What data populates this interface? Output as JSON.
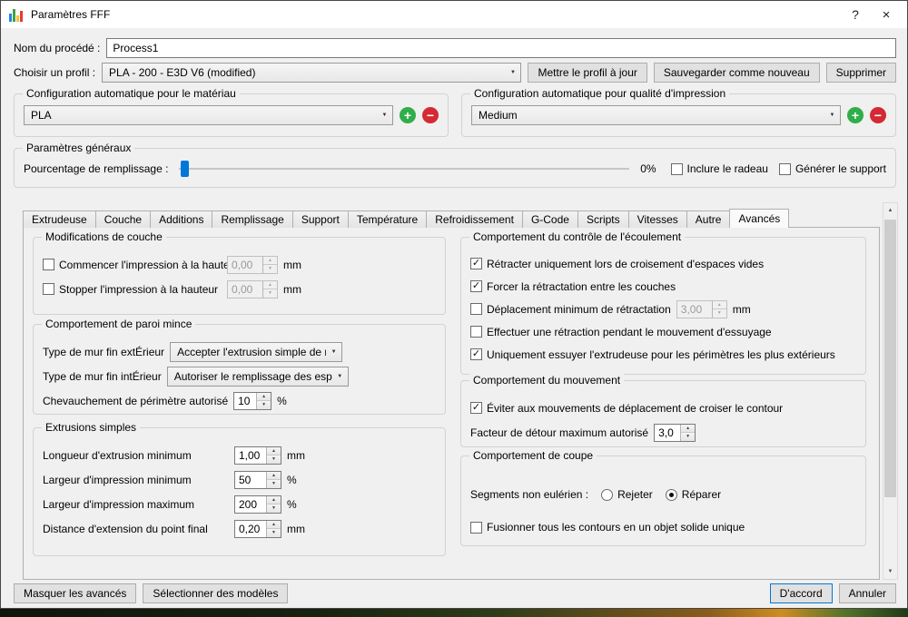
{
  "icons": {
    "up": "▲",
    "down": "▼",
    "dropdown": "▼",
    "scroll_up": "▲",
    "scroll_down": "▼"
  },
  "colors": {
    "accent_blue": "#0078d7",
    "add_green": "#2fae49",
    "remove_red": "#d42a33"
  },
  "window": {
    "title": "Paramètres FFF",
    "help": "?",
    "close": "×"
  },
  "header": {
    "process_label": "Nom du procédé :",
    "process_value": "Process1",
    "profile_label": "Choisir un profil :",
    "profile_value": "PLA - 200 - E3D V6 (modified)",
    "btn_update": "Mettre le profil à jour",
    "btn_save_new": "Sauvegarder comme nouveau",
    "btn_delete": "Supprimer"
  },
  "auto_material": {
    "title": "Configuration automatique pour le matériau",
    "value": "PLA",
    "add": "+",
    "remove": "−"
  },
  "auto_quality": {
    "title": "Configuration automatique pour qualité d'impression",
    "value": "Medium",
    "add": "+",
    "remove": "−"
  },
  "general": {
    "title": "Paramètres généraux",
    "infill_label": "Pourcentage de remplissage :",
    "infill_percent": "0%",
    "raft": {
      "label": "Inclure le radeau",
      "checked": false
    },
    "support": {
      "label": "Générer le support",
      "checked": false
    }
  },
  "tabs": {
    "items": [
      {
        "label": "Extrudeuse",
        "active": false
      },
      {
        "label": "Couche",
        "active": false
      },
      {
        "label": "Additions",
        "active": false
      },
      {
        "label": "Remplissage",
        "active": false
      },
      {
        "label": "Support",
        "active": false
      },
      {
        "label": "Température",
        "active": false
      },
      {
        "label": "Refroidissement",
        "active": false
      },
      {
        "label": "G-Code",
        "active": false
      },
      {
        "label": "Scripts",
        "active": false
      },
      {
        "label": "Vitesses",
        "active": false
      },
      {
        "label": "Autre",
        "active": false
      },
      {
        "label": "Avancés",
        "active": true
      }
    ]
  },
  "layer_mod": {
    "title": "Modifications de couche",
    "start": {
      "label": "Commencer l'impression à la hauteur",
      "checked": false,
      "value": "0,00",
      "unit": "mm"
    },
    "stop": {
      "label": "Stopper l'impression à la hauteur",
      "checked": false,
      "value": "0,00",
      "unit": "mm"
    }
  },
  "thin_wall": {
    "title": "Comportement de paroi mince",
    "external_label": "Type de mur fin extÉrieur",
    "external_value": "Accepter l'extrusion simple de murs",
    "internal_label": "Type de mur fin intÉrieur",
    "internal_value": "Autoriser le remplissage des espaces",
    "overlap_label": "Chevauchement de périmètre autorisé",
    "overlap_value": "10",
    "overlap_unit": "%"
  },
  "single_extrusion": {
    "title": "Extrusions simples",
    "rows": [
      {
        "label": "Longueur d'extrusion minimum",
        "value": "1,00",
        "unit": "mm"
      },
      {
        "label": "Largeur d'impression minimum",
        "value": "50",
        "unit": "%"
      },
      {
        "label": "Largeur d'impression maximum",
        "value": "200",
        "unit": "%"
      },
      {
        "label": "Distance d'extension du point final",
        "value": "0,20",
        "unit": "mm"
      }
    ]
  },
  "ooze": {
    "title": "Comportement du contrôle de l'écoulement",
    "retract_crossing": {
      "label": "Rétracter uniquement lors de croisement d'espaces vides",
      "checked": true
    },
    "force_retract": {
      "label": "Forcer la rétractation entre les couches",
      "checked": true
    },
    "min_travel": {
      "label": "Déplacement minimum de rétractation",
      "checked": false,
      "value": "3,00",
      "unit": "mm"
    },
    "wipe_retract": {
      "label": "Effectuer une rétraction pendant le mouvement d'essuyage",
      "checked": false
    },
    "wipe_outer": {
      "label": "Uniquement essuyer l'extrudeuse pour les périmètres les plus extérieurs",
      "checked": true
    }
  },
  "movement": {
    "title": "Comportement du mouvement",
    "avoid": {
      "label": "Éviter aux mouvements de déplacement de croiser le contour",
      "checked": true
    },
    "detour_label": "Facteur de détour maximum autorisé",
    "detour_value": "3,0"
  },
  "slicing": {
    "title": "Comportement de coupe",
    "segments_label": "Segments non eulérien :",
    "reject": {
      "label": "Rejeter",
      "checked": false
    },
    "repair": {
      "label": "Réparer",
      "checked": true
    },
    "merge": {
      "label": "Fusionner tous les contours en un objet solide unique",
      "checked": false
    }
  },
  "footer": {
    "hide_advanced": "Masquer les avancés",
    "select_models": "Sélectionner des modèles",
    "ok": "D'accord",
    "cancel": "Annuler"
  }
}
